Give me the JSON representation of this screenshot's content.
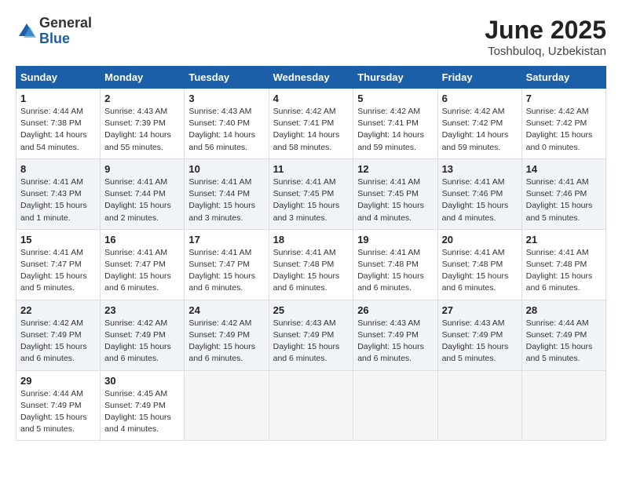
{
  "logo": {
    "general": "General",
    "blue": "Blue"
  },
  "title": "June 2025",
  "location": "Toshbuloq, Uzbekistan",
  "weekdays": [
    "Sunday",
    "Monday",
    "Tuesday",
    "Wednesday",
    "Thursday",
    "Friday",
    "Saturday"
  ],
  "weeks": [
    [
      {
        "day": "1",
        "info": "Sunrise: 4:44 AM\nSunset: 7:38 PM\nDaylight: 14 hours\nand 54 minutes."
      },
      {
        "day": "2",
        "info": "Sunrise: 4:43 AM\nSunset: 7:39 PM\nDaylight: 14 hours\nand 55 minutes."
      },
      {
        "day": "3",
        "info": "Sunrise: 4:43 AM\nSunset: 7:40 PM\nDaylight: 14 hours\nand 56 minutes."
      },
      {
        "day": "4",
        "info": "Sunrise: 4:42 AM\nSunset: 7:41 PM\nDaylight: 14 hours\nand 58 minutes."
      },
      {
        "day": "5",
        "info": "Sunrise: 4:42 AM\nSunset: 7:41 PM\nDaylight: 14 hours\nand 59 minutes."
      },
      {
        "day": "6",
        "info": "Sunrise: 4:42 AM\nSunset: 7:42 PM\nDaylight: 14 hours\nand 59 minutes."
      },
      {
        "day": "7",
        "info": "Sunrise: 4:42 AM\nSunset: 7:42 PM\nDaylight: 15 hours\nand 0 minutes."
      }
    ],
    [
      {
        "day": "8",
        "info": "Sunrise: 4:41 AM\nSunset: 7:43 PM\nDaylight: 15 hours\nand 1 minute."
      },
      {
        "day": "9",
        "info": "Sunrise: 4:41 AM\nSunset: 7:44 PM\nDaylight: 15 hours\nand 2 minutes."
      },
      {
        "day": "10",
        "info": "Sunrise: 4:41 AM\nSunset: 7:44 PM\nDaylight: 15 hours\nand 3 minutes."
      },
      {
        "day": "11",
        "info": "Sunrise: 4:41 AM\nSunset: 7:45 PM\nDaylight: 15 hours\nand 3 minutes."
      },
      {
        "day": "12",
        "info": "Sunrise: 4:41 AM\nSunset: 7:45 PM\nDaylight: 15 hours\nand 4 minutes."
      },
      {
        "day": "13",
        "info": "Sunrise: 4:41 AM\nSunset: 7:46 PM\nDaylight: 15 hours\nand 4 minutes."
      },
      {
        "day": "14",
        "info": "Sunrise: 4:41 AM\nSunset: 7:46 PM\nDaylight: 15 hours\nand 5 minutes."
      }
    ],
    [
      {
        "day": "15",
        "info": "Sunrise: 4:41 AM\nSunset: 7:47 PM\nDaylight: 15 hours\nand 5 minutes."
      },
      {
        "day": "16",
        "info": "Sunrise: 4:41 AM\nSunset: 7:47 PM\nDaylight: 15 hours\nand 6 minutes."
      },
      {
        "day": "17",
        "info": "Sunrise: 4:41 AM\nSunset: 7:47 PM\nDaylight: 15 hours\nand 6 minutes."
      },
      {
        "day": "18",
        "info": "Sunrise: 4:41 AM\nSunset: 7:48 PM\nDaylight: 15 hours\nand 6 minutes."
      },
      {
        "day": "19",
        "info": "Sunrise: 4:41 AM\nSunset: 7:48 PM\nDaylight: 15 hours\nand 6 minutes."
      },
      {
        "day": "20",
        "info": "Sunrise: 4:41 AM\nSunset: 7:48 PM\nDaylight: 15 hours\nand 6 minutes."
      },
      {
        "day": "21",
        "info": "Sunrise: 4:41 AM\nSunset: 7:48 PM\nDaylight: 15 hours\nand 6 minutes."
      }
    ],
    [
      {
        "day": "22",
        "info": "Sunrise: 4:42 AM\nSunset: 7:49 PM\nDaylight: 15 hours\nand 6 minutes."
      },
      {
        "day": "23",
        "info": "Sunrise: 4:42 AM\nSunset: 7:49 PM\nDaylight: 15 hours\nand 6 minutes."
      },
      {
        "day": "24",
        "info": "Sunrise: 4:42 AM\nSunset: 7:49 PM\nDaylight: 15 hours\nand 6 minutes."
      },
      {
        "day": "25",
        "info": "Sunrise: 4:43 AM\nSunset: 7:49 PM\nDaylight: 15 hours\nand 6 minutes."
      },
      {
        "day": "26",
        "info": "Sunrise: 4:43 AM\nSunset: 7:49 PM\nDaylight: 15 hours\nand 6 minutes."
      },
      {
        "day": "27",
        "info": "Sunrise: 4:43 AM\nSunset: 7:49 PM\nDaylight: 15 hours\nand 5 minutes."
      },
      {
        "day": "28",
        "info": "Sunrise: 4:44 AM\nSunset: 7:49 PM\nDaylight: 15 hours\nand 5 minutes."
      }
    ],
    [
      {
        "day": "29",
        "info": "Sunrise: 4:44 AM\nSunset: 7:49 PM\nDaylight: 15 hours\nand 5 minutes."
      },
      {
        "day": "30",
        "info": "Sunrise: 4:45 AM\nSunset: 7:49 PM\nDaylight: 15 hours\nand 4 minutes."
      },
      {
        "day": "",
        "info": ""
      },
      {
        "day": "",
        "info": ""
      },
      {
        "day": "",
        "info": ""
      },
      {
        "day": "",
        "info": ""
      },
      {
        "day": "",
        "info": ""
      }
    ]
  ]
}
